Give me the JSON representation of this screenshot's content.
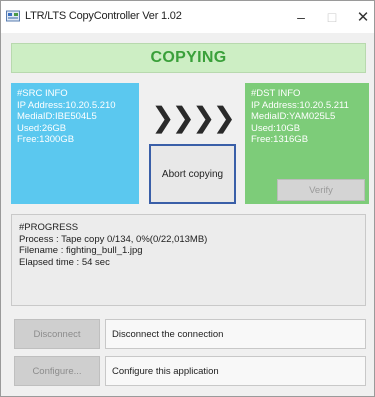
{
  "window": {
    "title": "LTR/LTS CopyController Ver 1.02",
    "controls": {
      "minimize": "–",
      "maximize": "□",
      "close": "✕"
    }
  },
  "status": {
    "text": "COPYING",
    "color": "#3aa03a",
    "background": "#cdeec4"
  },
  "src_info": {
    "header": "#SRC INFO",
    "ip": "IP Address:10.20.5.210",
    "media_id": "MediaID:IBE504L5",
    "used": "Used:26GB",
    "free": "Free:1300GB",
    "color": "#5bc8ef"
  },
  "dst_info": {
    "header": "#DST INFO",
    "ip": "IP Address:10.20.5.211",
    "media_id": "MediaID:YAM025L5",
    "used": "Used:10GB",
    "free": "Free:1316GB",
    "color": "#7dcc79"
  },
  "transfer_arrows": "❯❯❯❯",
  "buttons": {
    "abort": "Abort copying",
    "verify": "Verify",
    "disconnect": "Disconnect",
    "configure": "Configure..."
  },
  "progress": {
    "header": "#PROGRESS",
    "process": "Process : Tape copy  0/134, 0%(0/22,013MB)",
    "filename": "Filename : fighting_bull_1.jpg",
    "elapsed": "Elapsed time : 54 sec"
  },
  "descriptions": {
    "disconnect": "Disconnect the connection",
    "configure": "Configure this application"
  }
}
